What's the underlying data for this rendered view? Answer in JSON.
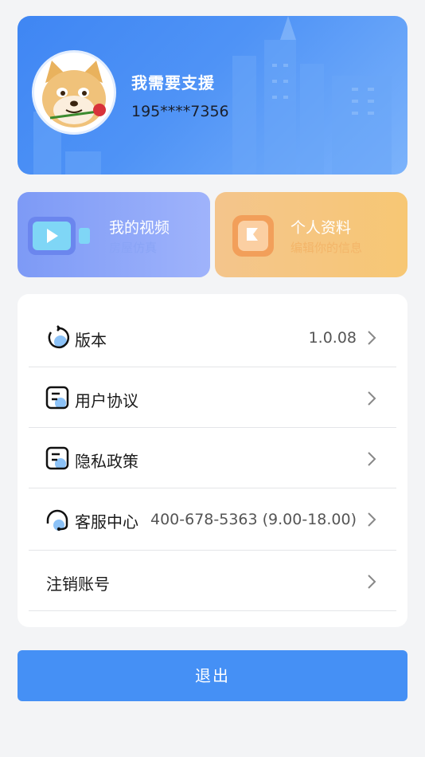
{
  "profile": {
    "name": "我需要支援",
    "phone": "195****7356",
    "avatar_icon": "shiba-dog-with-rose-avatar"
  },
  "quick_cards": [
    {
      "title": "我的视频",
      "subtitle": "房屋仿真",
      "icon": "video-play-icon",
      "color": "#7d9af6"
    },
    {
      "title": "个人资料",
      "subtitle": "编辑你的信息",
      "icon": "profile-card-icon",
      "color": "#f4c58c"
    }
  ],
  "menu": {
    "items": [
      {
        "label": "版本",
        "value": "1.0.08",
        "icon": "refresh-icon"
      },
      {
        "label": "用户协议",
        "value": "",
        "icon": "document-icon"
      },
      {
        "label": "隐私政策",
        "value": "",
        "icon": "document-icon"
      },
      {
        "label": "客服中心",
        "value": "400-678-5363 (9.00-18.00)",
        "icon": "headset-icon"
      },
      {
        "label": "注销账号",
        "value": "",
        "icon": ""
      }
    ]
  },
  "logout_label": "退出",
  "colors": {
    "accent": "#4590f5",
    "background": "#f3f4f6"
  }
}
